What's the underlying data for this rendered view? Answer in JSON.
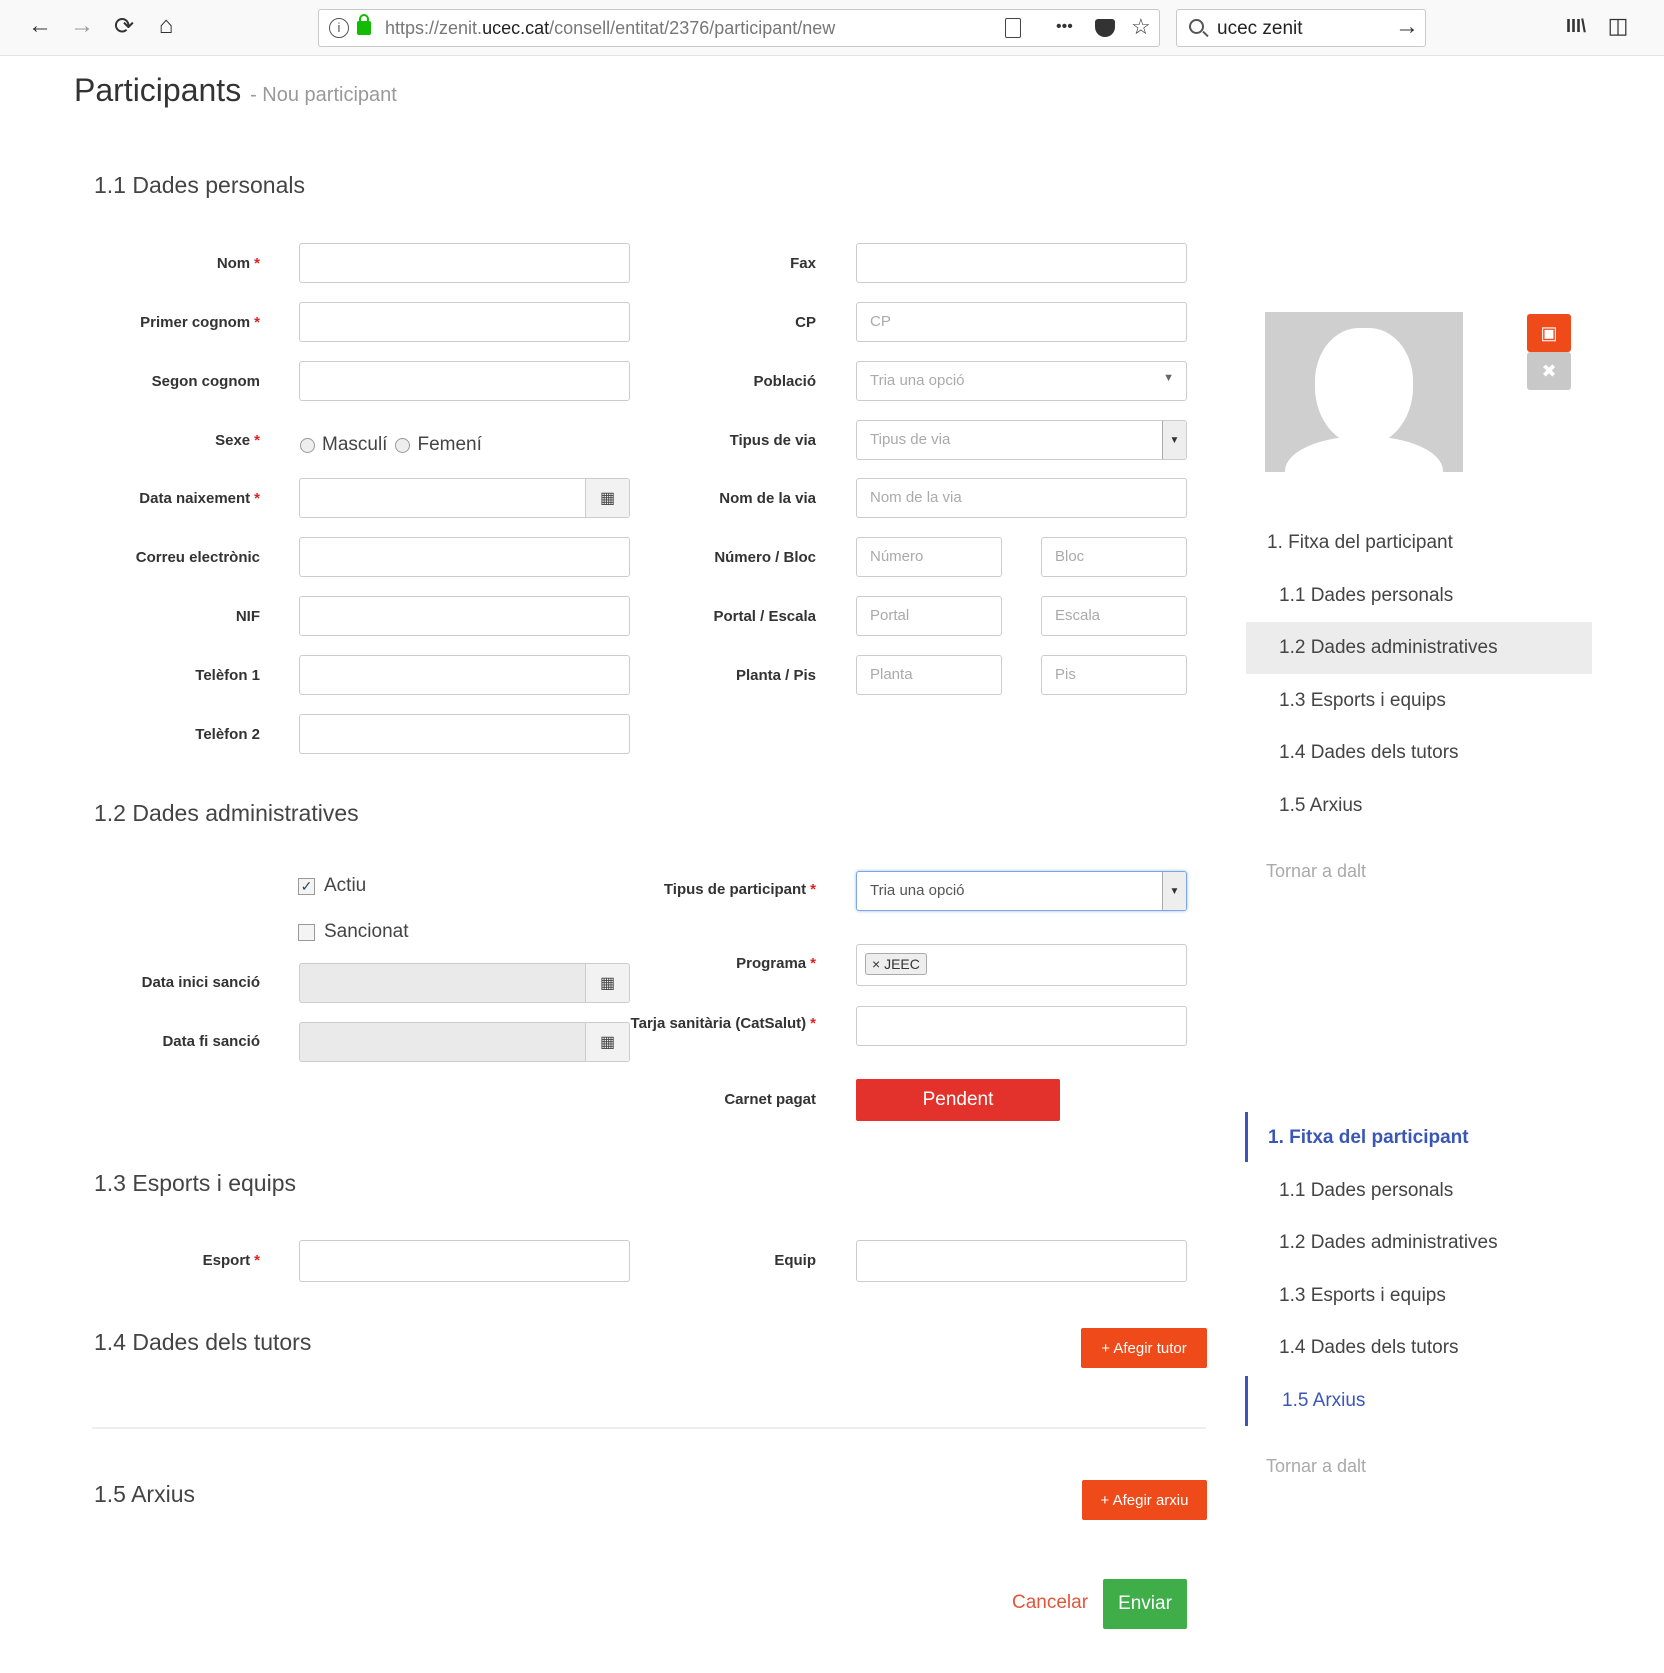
{
  "browser": {
    "url_prefix": "https://zenit.",
    "url_host": "ucec.cat",
    "url_path": "/consell/entitat/2376/participant/new",
    "search_value": "ucec zenit",
    "back_glyph": "←",
    "forward_glyph": "→",
    "reload_glyph": "⟳",
    "home_glyph": "⌂",
    "more_glyph": "•••",
    "go_glyph": "→",
    "library_glyph": "III\\",
    "sidebar_glyph": "◫"
  },
  "page": {
    "title": "Participants",
    "subtitle": "- Nou participant"
  },
  "sections": {
    "personal": "1.1 Dades personals",
    "admin": "1.2 Dades administratives",
    "sports": "1.3 Esports i equips",
    "tutors": "1.4 Dades dels tutors",
    "files": "1.5 Arxius"
  },
  "personal": {
    "nom": "Nom",
    "primer_cognom": "Primer cognom",
    "segon_cognom": "Segon cognom",
    "sexe": "Sexe",
    "masculi": "Masculí",
    "femeni": "Femení",
    "data_naixement": "Data naixement",
    "correu": "Correu electrònic",
    "nif": "NIF",
    "telefon1": "Telèfon 1",
    "telefon2": "Telèfon 2",
    "fax": "Fax",
    "cp": "CP",
    "cp_placeholder": "CP",
    "poblacio": "Població",
    "poblacio_placeholder": "Tria una opció",
    "tipus_via": "Tipus de via",
    "tipus_via_placeholder": "Tipus de via",
    "nom_via": "Nom de la via",
    "nom_via_placeholder": "Nom de la via",
    "numero_bloc": "Número / Bloc",
    "numero_placeholder": "Número",
    "bloc_placeholder": "Bloc",
    "portal_escala": "Portal / Escala",
    "portal_placeholder": "Portal",
    "escala_placeholder": "Escala",
    "planta_pis": "Planta / Pis",
    "planta_placeholder": "Planta",
    "pis_placeholder": "Pis"
  },
  "admin": {
    "actiu": "Actiu",
    "sancionat": "Sancionat",
    "data_inici_sancio": "Data inici sanció",
    "data_fi_sancio": "Data fi sanció",
    "tipus_participant": "Tipus de participant",
    "tipus_participant_value": "Tria una opció",
    "programa": "Programa",
    "programa_tag": "× JEEC",
    "tarja_sanitaria": "Tarja sanitària (CatSalut)",
    "carnet_pagat": "Carnet pagat",
    "pendent": "Pendent"
  },
  "sports": {
    "esport": "Esport",
    "equip": "Equip"
  },
  "buttons": {
    "afegir_tutor": "+ Afegir tutor",
    "afegir_arxiu": "+ Afegir arxiu",
    "cancelar": "Cancelar",
    "enviar": "Enviar",
    "required_mark": "*",
    "calendar_glyph": "▦",
    "caret_glyph": "▼",
    "image_glyph": "▣",
    "remove_glyph": "✖"
  },
  "toc_top": {
    "items": [
      "1. Fitxa del participant",
      "1.1 Dades personals",
      "1.2 Dades administratives",
      "1.3 Esports i equips",
      "1.4 Dades dels tutors",
      "1.5 Arxius"
    ],
    "back_to_top": "Tornar a dalt"
  },
  "toc_bottom": {
    "items": [
      "1. Fitxa del participant",
      "1.1 Dades personals",
      "1.2 Dades administratives",
      "1.3 Esports i equips",
      "1.4 Dades dels tutors",
      "1.5 Arxius"
    ],
    "back_to_top": "Tornar a dalt"
  },
  "colors": {
    "accent_blue": "#3a56b6",
    "danger": "#e3322b",
    "orange": "#ee4a1a",
    "success": "#3fae49"
  }
}
